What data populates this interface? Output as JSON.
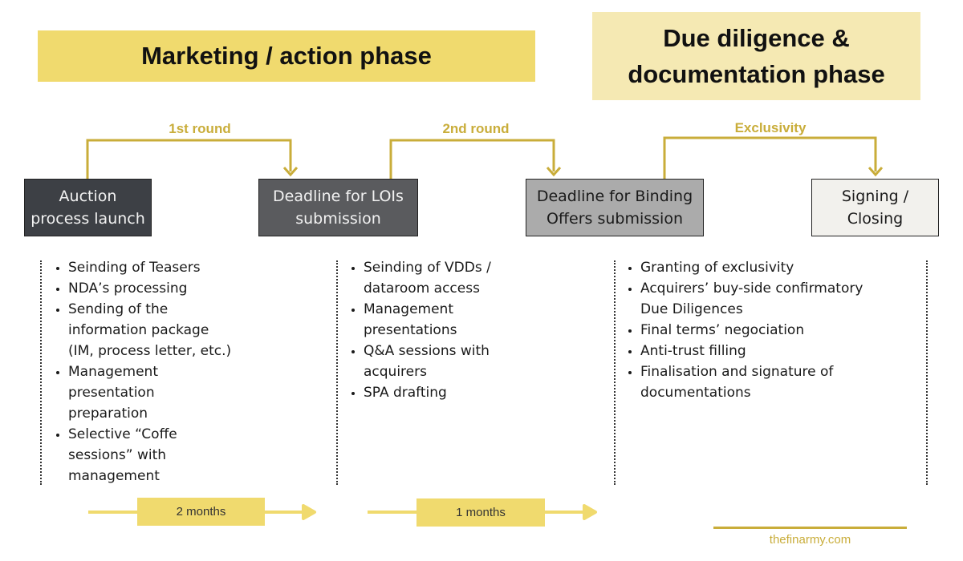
{
  "phases": {
    "marketing": "Marketing / action phase",
    "due_diligence_line1": "Due diligence &",
    "due_diligence_line2": "documentation phase"
  },
  "rounds": {
    "first": "1st round",
    "second": "2nd round",
    "exclusivity": "Exclusivity"
  },
  "milestones": [
    {
      "line1": "Auction",
      "line2": "process launch"
    },
    {
      "line1": "Deadline for LOIs",
      "line2": "submission"
    },
    {
      "line1": "Deadline for Binding",
      "line2": "Offers submission"
    },
    {
      "line1": "Signing /",
      "line2": "Closing"
    }
  ],
  "task_columns": [
    {
      "items": [
        "Seinding of Teasers",
        "NDA’s processing",
        "Sending of the information package (IM, process letter, etc.)",
        "Management presentation preparation",
        "Selective “Coffe sessions” with management"
      ]
    },
    {
      "items": [
        "Seinding of VDDs / dataroom access",
        "Management presentations",
        "Q&A sessions with acquirers",
        "SPA drafting"
      ]
    },
    {
      "items": [
        "Granting of exclusivity",
        "Acquirers’ buy-side confirmatory Due Diligences",
        "Final terms’ negociation",
        "Anti-trust filling",
        "Finalisation and signature of documentations"
      ]
    }
  ],
  "durations": {
    "first": "2 months",
    "second": "1 months"
  },
  "footer": {
    "site": "thefinarmy.com"
  },
  "colors": {
    "gold": "#c9ad3a",
    "banner_yellow": "#f0da6e",
    "banner_pale": "#f5e9b3",
    "milestone_dark": "#3d4045",
    "milestone_mid": "#5a5b5e",
    "milestone_light": "#ababab",
    "milestone_pale": "#f2f1ed"
  }
}
